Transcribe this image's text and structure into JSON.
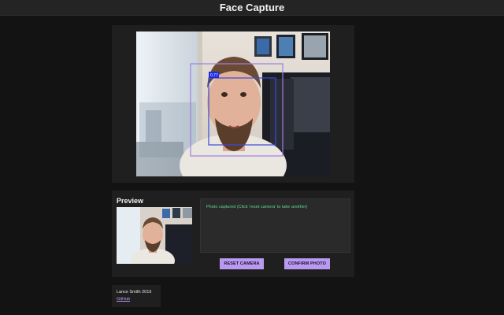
{
  "header": {
    "title": "Face Capture"
  },
  "camera": {
    "detection_score": "0.77",
    "outer_box_color": "#a07ee6",
    "inner_box_color": "#3d49d8"
  },
  "preview": {
    "heading": "Preview",
    "status_message": "Photo captured (Click 'reset camera' to take another)",
    "reset_button": "RESET CAMERA",
    "confirm_button": "CONFIRM PHOTO"
  },
  "footer": {
    "credit": "Lance Smith 2019",
    "link_label": "GitHub"
  },
  "colors": {
    "accent": "#b89af0",
    "status_text": "#5fd38d",
    "background": "#131313",
    "panel": "#1f1f1f"
  }
}
